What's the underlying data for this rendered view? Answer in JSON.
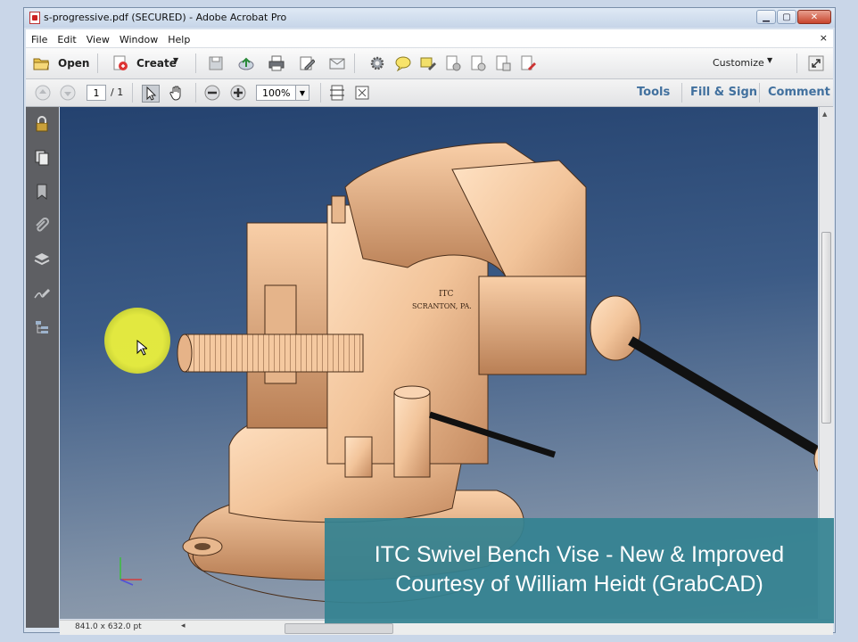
{
  "window": {
    "title": "s-progressive.pdf (SECURED) - Adobe Acrobat Pro",
    "buttons": [
      "minimize",
      "maximize",
      "close"
    ]
  },
  "menu": {
    "items": [
      "File",
      "Edit",
      "View",
      "Window",
      "Help"
    ],
    "close_glyph": "×"
  },
  "toolbar": {
    "open_label": "Open",
    "create_label": "Create",
    "customize_label": "Customize",
    "icons": [
      "folder-icon",
      "create-pdf-icon",
      "save-icon",
      "upload-icon",
      "print-icon",
      "edit-icon",
      "email-icon",
      "gear-icon",
      "comment-icon",
      "highlight-icon",
      "doc-lock-icon",
      "doc-gear-icon",
      "doc-export-icon",
      "doc-sign-icon",
      "expand-icon"
    ]
  },
  "navbar": {
    "page_current": "1",
    "page_total": "/ 1",
    "zoom": "100%",
    "tools_label": "Tools",
    "fill_sign_label": "Fill & Sign",
    "comment_label": "Comment"
  },
  "left_panel": {
    "icons": [
      "lock-icon",
      "pages-icon",
      "bookmark-icon",
      "attachment-icon",
      "layers-icon",
      "signature-icon",
      "model-tree-icon"
    ]
  },
  "statusbar": {
    "page_size": "841.0 x 632.0 pt"
  },
  "document": {
    "model_text_line1": "ITC",
    "model_text_line2": "SCRANTON, PA."
  },
  "overlay": {
    "line1": "ITC Swivel Bench Vise - New & Improved",
    "line2": "Courtesy of William Heidt (GrabCAD)"
  },
  "colors": {
    "canvas_top": "#24426f",
    "model": "#f2c49a",
    "overlay": "#34828f",
    "highlight": "#ebf03c",
    "link": "#41709e"
  }
}
